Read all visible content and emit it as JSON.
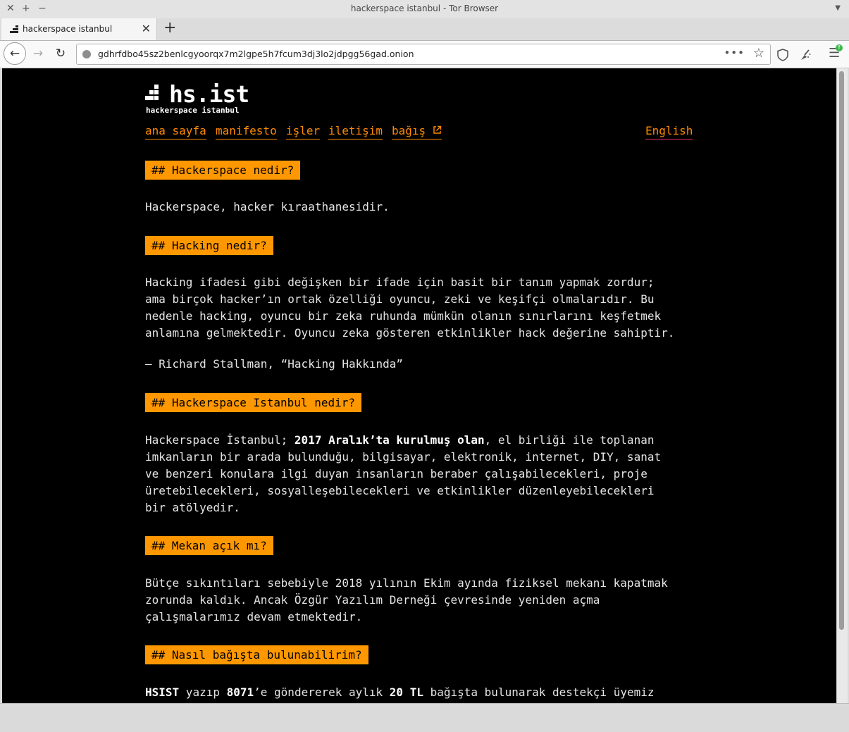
{
  "window": {
    "title": "hackerspace istanbul - Tor Browser"
  },
  "tab": {
    "title": "hackerspace istanbul"
  },
  "url": "gdhrfdbo45sz2benlcgyoorqx7m2lgpe5h7fcum3dj3lo2jdpgg56gad.onion",
  "site": {
    "logo_text": "hs.ist",
    "logo_subtitle": "hackerspace istanbul",
    "nav": [
      "ana sayfa",
      "manifesto",
      "işler",
      "iletişim",
      "bağış"
    ],
    "lang_link": "English"
  },
  "sections": [
    {
      "heading": "## Hackerspace nedir?",
      "body": "Hackerspace, hacker kıraathanesidir."
    },
    {
      "heading": "## Hacking nedir?",
      "body": "Hacking ifadesi gibi değişken bir ifade için basit bir tanım yapmak zordur;\nama birçok hacker’ın ortak özelliği oyuncu, zeki ve keşifçi olmalarıdır. Bu\nnedenle hacking, oyuncu bir zeka ruhunda mümkün olanın sınırlarını keşfetmek\nanlamına gelmektedir. Oyuncu zeka gösteren etkinlikler hack değerine sahiptir.",
      "quote": "– Richard Stallman, “Hacking Hakkında”"
    },
    {
      "heading": "## Hackerspace Istanbul nedir?",
      "body_pre": "Hackerspace İstanbul; ",
      "body_bold": "2017 Aralık’ta kurulmuş olan",
      "body_post": ", el birliği ile toplanan\nimkanların bir arada bulunduğu, bilgisayar, elektronik, internet, DIY, sanat\nve benzeri konulara ilgi duyan insanların beraber çalışabilecekleri, proje\nüretebilecekleri, sosyalleşebilecekleri ve etkinlikler düzenleyebilecekleri\nbir atölyedir."
    },
    {
      "heading": "## Mekan açık mı?",
      "body": "Bütçe sıkıntıları sebebiyle 2018 yılının Ekim ayında fiziksel mekanı kapatmak\nzorunda kaldık. Ancak Özgür Yazılım Derneği çevresinde yeniden açma\nçalışmalarımız devam etmektedir."
    },
    {
      "heading": "## Nasıl bağışta bulunabilirim?",
      "b1": "HSIST",
      "t1": " yazıp ",
      "b2": "8071",
      "t2": "’e göndererek aylık ",
      "b3": "20 TL",
      "t3": " bağışta bulunarak destekçi üyemiz"
    }
  ]
}
